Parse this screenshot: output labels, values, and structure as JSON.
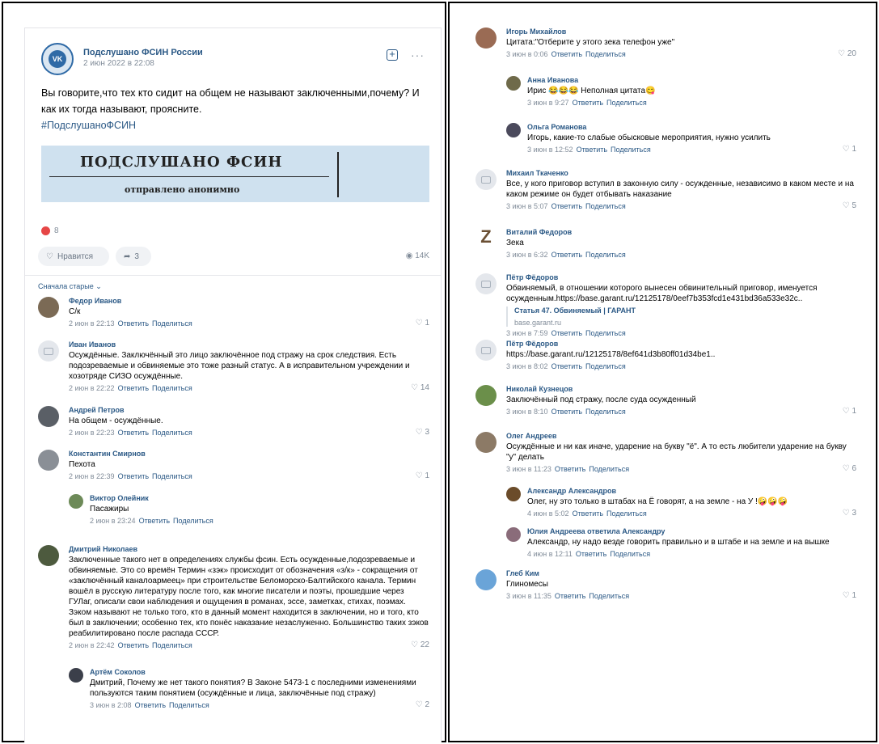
{
  "post": {
    "group": "Подслушано ФСИН России",
    "date": "2 июн 2022 в 22:08",
    "logo_text": "VK",
    "text": "Вы говорите,что тех кто сидит на общем не называют заключенными,почему? И как их тогда называют, проясните.",
    "hashtag": "#ПодслушаноФСИН",
    "banner_title": "ПОДСЛУШАНО ФСИН",
    "banner_sub": "отправлено анонимно",
    "reactions": "8",
    "like_label": "Нравится",
    "share_count": "3",
    "views": "14K",
    "sort_label": "Сначала старые ⌄",
    "accent": "#2a5885"
  },
  "left_comments": [
    {
      "name": "Федор Иванов",
      "text": "С/к",
      "date": "2 июн в 22:13",
      "likes": "1",
      "avatar": "#7b6a55"
    },
    {
      "name": "Иван Иванов",
      "text": "Осуждённые. Заключённый это лицо заключённое под стражу на срок следствия. Есть подозреваемые и обвиняемые это тоже разный статус. А в исправительном учреждении и хозотряде СИЗО осуждённые.",
      "date": "2 июн в 22:22",
      "likes": "14",
      "avatar": "camera"
    },
    {
      "name": "Андрей Петров",
      "text": "На общем - осуждённые.",
      "date": "2 июн в 22:23",
      "likes": "3",
      "avatar": "#5a5f66"
    },
    {
      "name": "Константин Смирнов",
      "text": "Пехота",
      "date": "2 июн в 22:39",
      "likes": "1",
      "avatar": "#8a8f96"
    },
    {
      "name": "Виктор Олейник",
      "text": "Пасажиры",
      "date": "2 июн в 23:24",
      "likes": "",
      "avatar": "#6d8a58",
      "reply": true
    },
    {
      "name": "Дмитрий Николаев",
      "text": "Заключенные такого нет в определениях службы фсин. Есть осужденные,подозреваемые и обвиняемые. Это со времён Термин «зэк» происходит от обозначения «з/к» - сокращения от «заключённый каналоармеец» при строительстве Беломорско-Балтийского канала. Термин вошёл в русскую литературу после того, как многие писатели и поэты, прошедшие через ГУЛаг, описали свои наблюдения и ощущения в романах, эссе, заметках, стихах, поэмах. Зэком называют не только того, кто в данный момент находится в заключении, но и того, кто был в заключении; особенно тех, кто понёс наказание незаслуженно. Большинство таких зэков реабилитировано после распада СССР.",
      "date": "2 июн в 22:42",
      "likes": "22",
      "avatar": "#4d5a3e"
    },
    {
      "name": "Артём Соколов",
      "text": "Дмитрий, Почему же нет такого понятия? В Законе 5473-1 с последними изменениями пользуются таким понятием (осуждённые и лица, заключённые под стражу)",
      "date": "3 июн в 2:08",
      "likes": "2",
      "avatar": "#3b3f4a",
      "reply": true
    }
  ],
  "right_comments": [
    {
      "name": "Игорь Михайлов",
      "text": "Цитата:\"Отберите у этого зека телефон уже\"",
      "date": "3 июн в 0:06",
      "likes": "20",
      "avatar": "#9a6b54"
    },
    {
      "name": "Анна Иванова",
      "text": "Ирис 😂😂😂 Неполная цитата😋",
      "date": "3 июн в 9:27",
      "likes": "",
      "avatar": "#6f6a4a",
      "reply": true
    },
    {
      "name": "Ольга Романова",
      "text": "Игорь, какие-то слабые обысковые мероприятия, нужно усилить",
      "date": "3 июн в 12:52",
      "likes": "1",
      "avatar": "#4b4a5c",
      "reply": true
    },
    {
      "name": "Михаил Ткаченко",
      "text": "Все, у кого приговор вступил в законную силу - осужденные, независимо в каком месте и на каком режиме он будет отбывать наказание",
      "date": "3 июн в 5:07",
      "likes": "5",
      "avatar": "camera"
    },
    {
      "name": "Виталий Федоров",
      "text": "Зека",
      "date": "3 июн в 6:32",
      "likes": "",
      "avatar": "z"
    },
    {
      "name": "Пётр Фёдоров",
      "text": "Обвиняемый, в отношении которого вынесен обвинительный приговор, именуется осужденным.https://base.garant.ru/12125178/0eef7b353fcd1e431bd36a533e32c..",
      "date": "3 июн в 7:59",
      "likes": "",
      "avatar": "camera",
      "link_title": "Статья 47. Обвиняемый | ГАРАНТ",
      "link_sub": "base.garant.ru"
    },
    {
      "name": "Пётр Фёдоров",
      "text": "https://base.garant.ru/12125178/8ef641d3b80ff01d34be1..",
      "date": "3 июн в 8:02",
      "likes": "",
      "avatar": "camera"
    },
    {
      "name": "Николай Кузнецов",
      "text": "Заключённый под стражу, после суда осужденный",
      "date": "3 июн в 8:10",
      "likes": "1",
      "avatar": "#6b8f4a"
    },
    {
      "name": "Олег Андреев",
      "text": "Осуждённые и ни как иначе, ударение на букву \"ё\". А то есть любители ударение на букву \"у\" делать",
      "date": "3 июн в 11:23",
      "likes": "6",
      "avatar": "#8c7a66"
    },
    {
      "name": "Александр Александров",
      "text": "Олег, ну это только в штабах на Ё говорят, а на земле - на У !🤪🤪🤪",
      "date": "4 июн в 5:02",
      "likes": "3",
      "avatar": "#6b4c2a",
      "reply": true
    },
    {
      "name": "Юлия Андреева ответила Александру",
      "text": "Александр, ну надо везде говорить правильно и в штабе и на земле и на вышке",
      "date": "4 июн в 12:11",
      "likes": "",
      "avatar": "#8a6c7a",
      "reply": true
    },
    {
      "name": "Глеб Ким",
      "text": "Глиномесы",
      "date": "3 июн в 11:35",
      "likes": "1",
      "avatar": "#6aa4d8"
    }
  ],
  "labels": {
    "reply": "Ответить",
    "share": "Поделиться"
  }
}
